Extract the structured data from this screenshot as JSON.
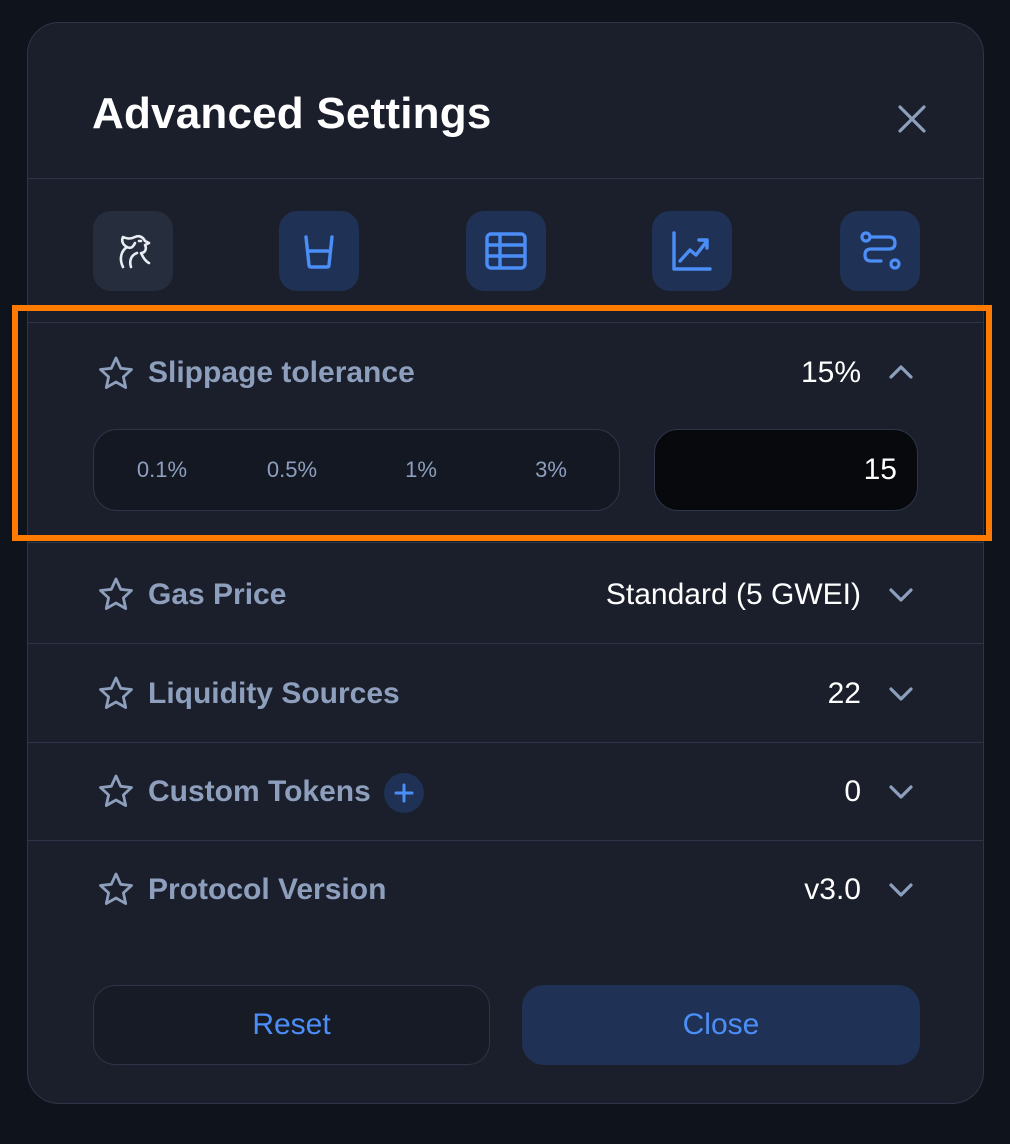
{
  "header": {
    "title": "Advanced Settings",
    "close_icon": "close-icon"
  },
  "toolbar": {
    "buttons": [
      {
        "icon": "dragon-icon"
      },
      {
        "icon": "cup-icon"
      },
      {
        "icon": "table-icon"
      },
      {
        "icon": "trending-up-icon"
      },
      {
        "icon": "route-icon"
      }
    ]
  },
  "slippage": {
    "label": "Slippage tolerance",
    "value": "15%",
    "presets": [
      "0.1%",
      "0.5%",
      "1%",
      "3%"
    ],
    "custom_value": "15",
    "expanded": true
  },
  "gas_price": {
    "label": "Gas Price",
    "value": "Standard (5 GWEI)"
  },
  "liquidity_sources": {
    "label": "Liquidity Sources",
    "value": "22"
  },
  "custom_tokens": {
    "label": "Custom Tokens",
    "value": "0"
  },
  "protocol_version": {
    "label": "Protocol Version",
    "value": "v3.0"
  },
  "footer": {
    "reset_label": "Reset",
    "close_label": "Close"
  },
  "colors": {
    "accent": "#4c8ef7",
    "highlight": "#ff7a00",
    "label": "#8e9fbd",
    "background": "#1a1f2b"
  }
}
